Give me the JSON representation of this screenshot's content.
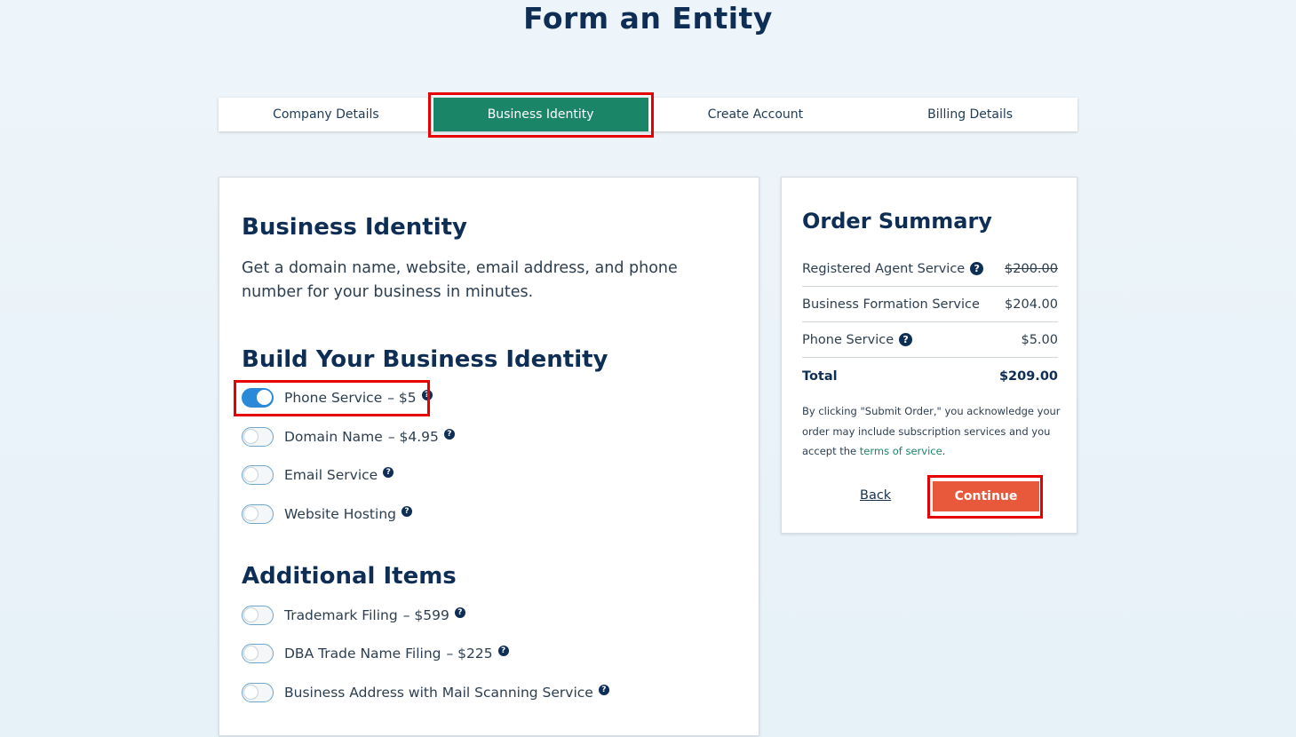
{
  "page": {
    "title": "Form an Entity"
  },
  "steps": [
    {
      "label": "Company Details",
      "active": false
    },
    {
      "label": "Business Identity",
      "active": true
    },
    {
      "label": "Create Account",
      "active": false
    },
    {
      "label": "Billing Details",
      "active": false
    }
  ],
  "main": {
    "heading": "Business Identity",
    "intro": "Get a domain name, website, email address, and phone number for your business in minutes.",
    "build_heading": "Build Your Business Identity",
    "build_options": [
      {
        "name": "Phone Service",
        "price": "– $5",
        "on": true
      },
      {
        "name": "Domain Name",
        "price": "– $4.95",
        "on": false
      },
      {
        "name": "Email Service",
        "price": "",
        "on": false
      },
      {
        "name": "Website Hosting",
        "price": "",
        "on": false
      }
    ],
    "additional_heading": "Additional Items",
    "additional_options": [
      {
        "name": "Trademark Filing",
        "price": "– $599",
        "on": false
      },
      {
        "name": "DBA Trade Name Filing",
        "price": "– $225",
        "on": false
      },
      {
        "name": "Business Address with Mail Scanning Service",
        "price": "",
        "on": false
      }
    ]
  },
  "summary": {
    "title": "Order Summary",
    "rows": [
      {
        "label": "Registered Agent Service",
        "value": "$200.00",
        "strike": true,
        "help": true
      },
      {
        "label": "Business Formation Service",
        "value": "$204.00",
        "strike": false,
        "help": false
      },
      {
        "label": "Phone Service",
        "value": "$5.00",
        "strike": false,
        "help": true
      }
    ],
    "total_label": "Total",
    "total_value": "$209.00",
    "legal_prefix": "By clicking \"Submit Order,\" you acknowledge your order may include subscription services and you accept the ",
    "legal_link": "terms of service",
    "legal_suffix": ".",
    "back_label": "Back",
    "continue_label": "Continue"
  },
  "colors": {
    "accent_green": "#1b8567",
    "continue_orange": "#e8583a",
    "toggle_on_blue": "#2b8ad8",
    "highlight_red": "#e60000"
  },
  "icons": {
    "help": "question-circle-icon"
  }
}
